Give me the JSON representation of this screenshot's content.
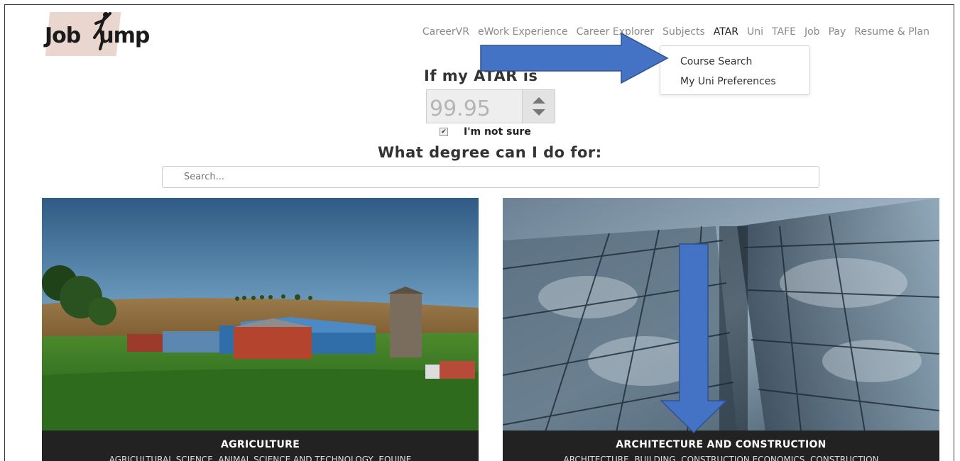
{
  "logo": {
    "text_left": "Job",
    "text_right": "ump"
  },
  "nav": {
    "items": [
      {
        "label": "CareerVR",
        "active": false
      },
      {
        "label": "eWork Experience",
        "active": false
      },
      {
        "label": "Career Explorer",
        "active": false
      },
      {
        "label": "Subjects",
        "active": false
      },
      {
        "label": "ATAR",
        "active": true
      },
      {
        "label": "Uni",
        "active": false
      },
      {
        "label": "TAFE",
        "active": false
      },
      {
        "label": "Job",
        "active": false
      },
      {
        "label": "Pay",
        "active": false
      },
      {
        "label": "Resume & Plan",
        "active": false
      }
    ],
    "dropdown": {
      "items": [
        "Course Search",
        "My Uni Preferences"
      ]
    }
  },
  "form": {
    "atar_heading": "If my ATAR is",
    "atar_value": "99.95",
    "not_sure_label": "I'm not sure",
    "not_sure_checked": true,
    "degree_heading": "What degree can I do for:",
    "search_placeholder": "Search..."
  },
  "cards": [
    {
      "title": "AGRICULTURE",
      "subtitle": "AGRICULTURAL SCIENCE, ANIMAL SCIENCE AND TECHNOLOGY, EQUINE"
    },
    {
      "title": "ARCHITECTURE AND CONSTRUCTION",
      "subtitle": "ARCHITECTURE, BUILDING, CONSTRUCTION ECONOMICS, CONSTRUCTION"
    }
  ],
  "colors": {
    "arrow": "#4472c4",
    "caption_bg": "#222222",
    "nav_text": "#8a8a8a",
    "nav_active": "#1f1f1f"
  },
  "icons": [
    "stepper-up-icon",
    "stepper-down-icon",
    "checkbox-check-icon",
    "annotation-arrow-right",
    "annotation-arrow-down"
  ]
}
